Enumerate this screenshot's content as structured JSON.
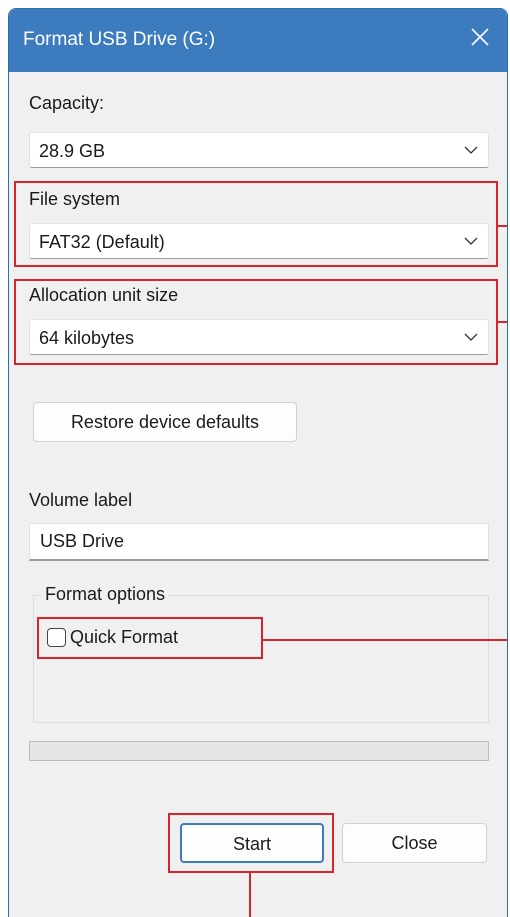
{
  "window": {
    "title": "Format USB Drive (G:)"
  },
  "capacity": {
    "label": "Capacity:",
    "value": "28.9 GB"
  },
  "file_system": {
    "label": "File system",
    "value": "FAT32 (Default)"
  },
  "allocation": {
    "label": "Allocation unit size",
    "value": "64 kilobytes"
  },
  "restore_button": "Restore device defaults",
  "volume": {
    "label": "Volume label",
    "value": "USB Drive"
  },
  "format_options": {
    "legend": "Format options",
    "quick_format_label": "Quick Format",
    "quick_format_checked": false
  },
  "progress": {
    "value": 0
  },
  "buttons": {
    "start": "Start",
    "close": "Close"
  },
  "colors": {
    "titlebar": "#3c7bbd",
    "highlight": "#d7242f",
    "background": "#f0f0f0"
  }
}
